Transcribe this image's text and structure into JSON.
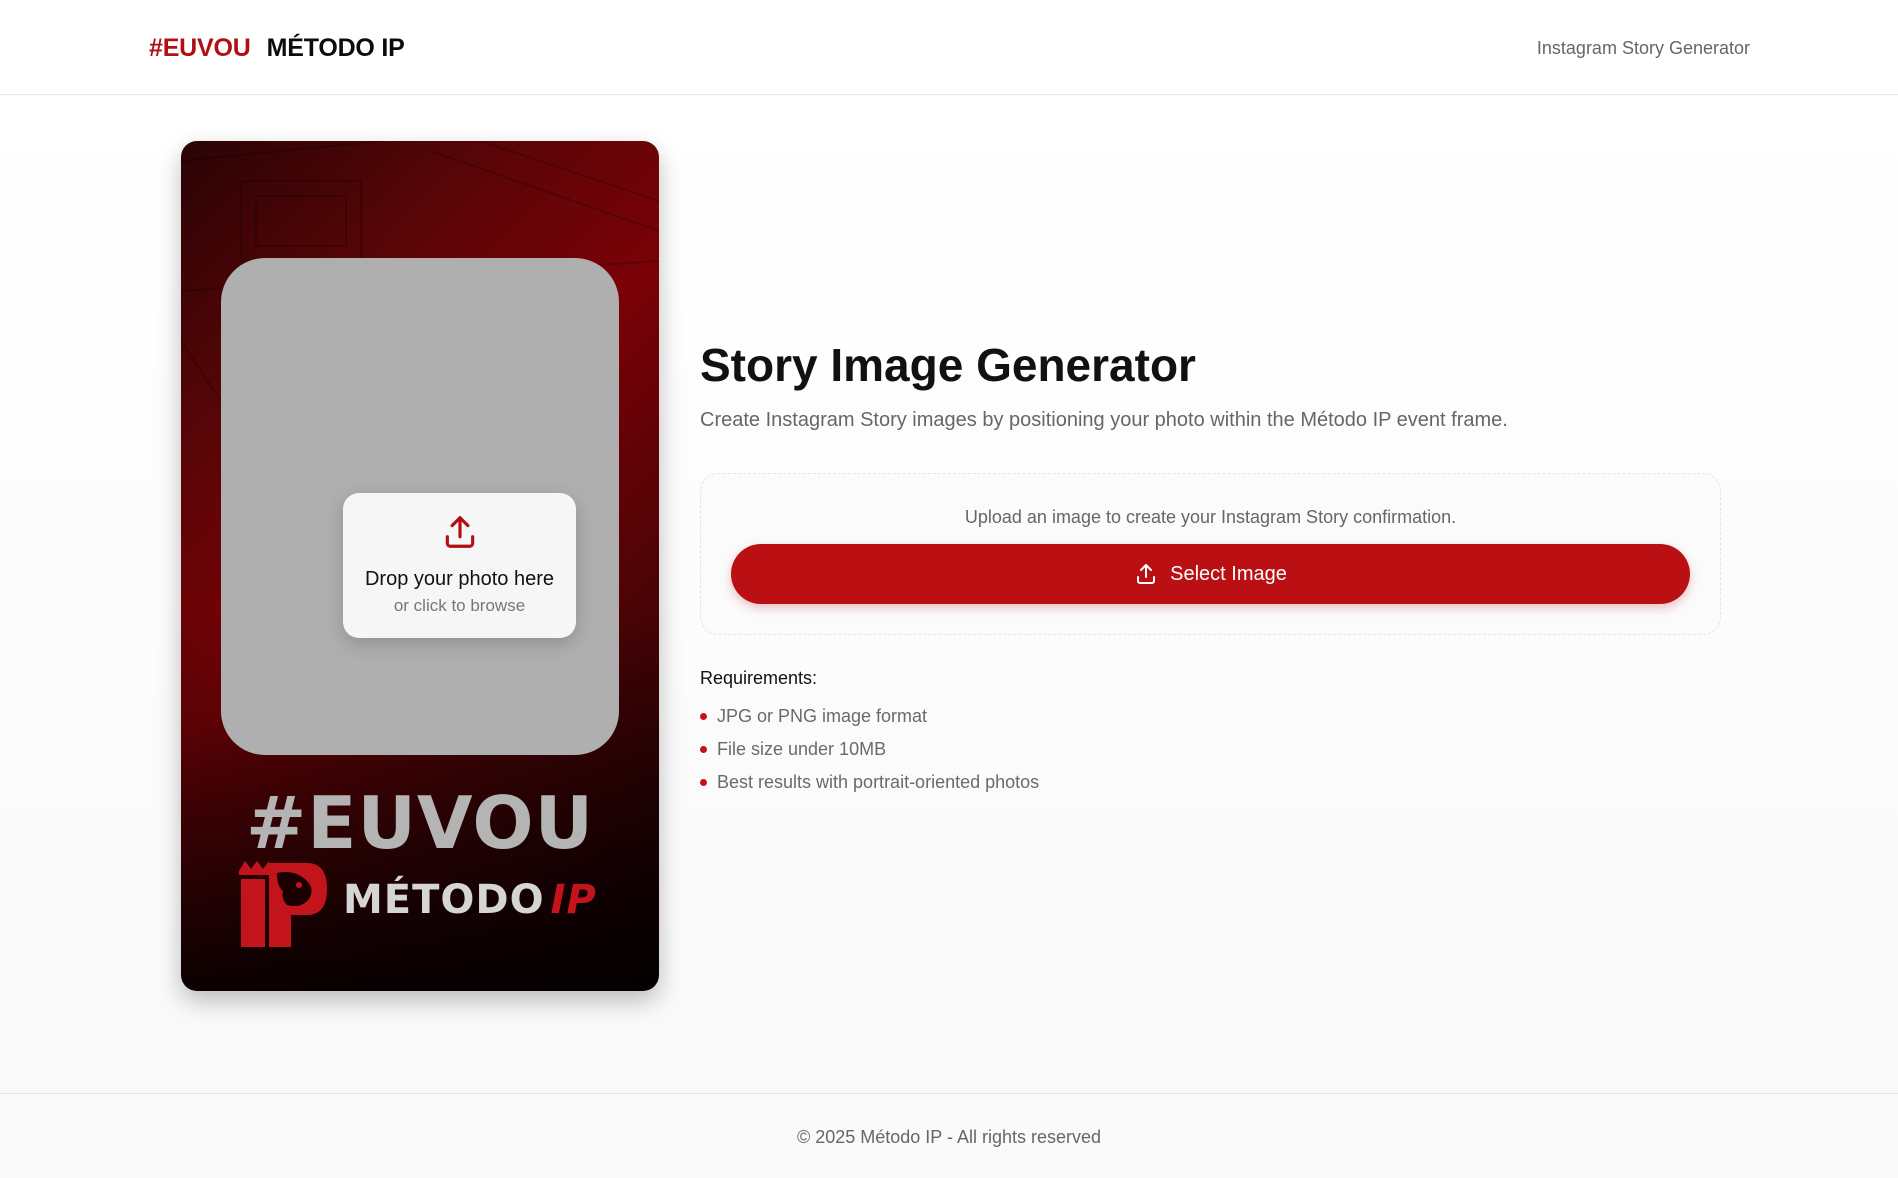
{
  "header": {
    "brand_hash": "#EUVOU",
    "brand_name": "MÉTODO IP",
    "nav_link": "Instagram Story Generator"
  },
  "story_preview": {
    "dropzone_title": "Drop your photo here",
    "dropzone_subtitle": "or click to browse",
    "hashtag": "#EUVOU",
    "logo_text": "MÉTODO",
    "logo_ip": "IP",
    "upload_icon": "upload-icon",
    "logo_icon": "lion-ip-logo-icon"
  },
  "main": {
    "title": "Story Image Generator",
    "subtitle": "Create Instagram Story images by positioning your photo within the Método IP event frame.",
    "upload_hint": "Upload an image to create your Instagram Story confirmation.",
    "select_button": "Select Image",
    "requirements_title": "Requirements:",
    "requirements": [
      "JPG or PNG image format",
      "File size under 10MB",
      "Best results with portrait-oriented photos"
    ]
  },
  "footer": {
    "text": "© 2025 Método IP - All rights reserved"
  },
  "colors": {
    "accent": "#ba1014",
    "brand_red": "#b01014",
    "text_muted": "#666666",
    "photo_slot": "#afafaf"
  }
}
